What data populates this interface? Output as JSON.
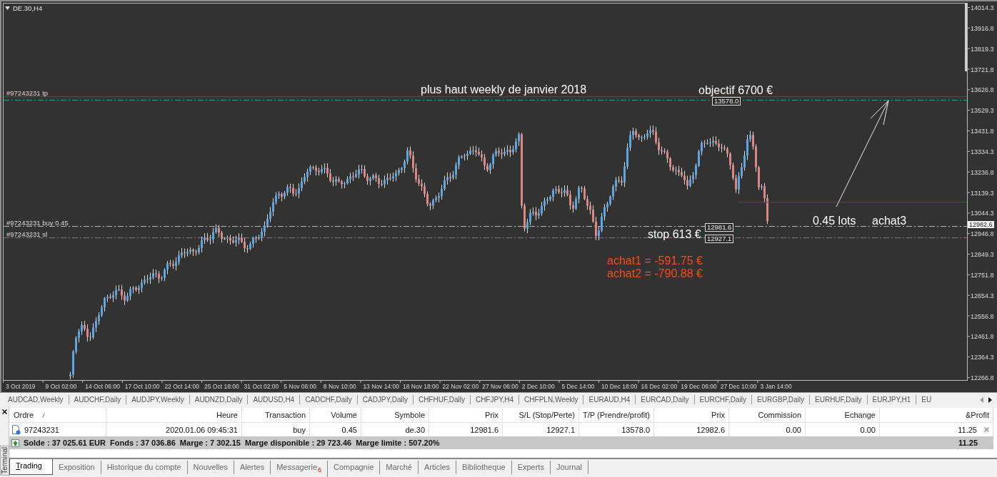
{
  "chart": {
    "title": "DE.30,H4",
    "trade_lines": [
      {
        "kind": "tp",
        "label": "#97243231 tp",
        "price_tag": "13578.0"
      },
      {
        "kind": "buy",
        "label": "#97243231 buy 0.45",
        "price_tag": "12981.6"
      },
      {
        "kind": "sl",
        "label": "#97243231 sl",
        "price_tag": "12927.1"
      }
    ],
    "notes": [
      {
        "kind": "resistance",
        "text": "plus haut weekly de janvier 2018"
      },
      {
        "kind": "target",
        "text": "objectif 6700 €"
      },
      {
        "kind": "lots",
        "text": "0.45 lots"
      },
      {
        "kind": "position",
        "text": "achat3"
      },
      {
        "kind": "stop",
        "text": "stop 613 €"
      }
    ],
    "losses": [
      "achat1 = -591.75 €",
      "achat2 = -790.88 €"
    ],
    "price_axis": {
      "labels": [
        "14014.3",
        "13916.8",
        "13819.3",
        "13721.8",
        "13626.8",
        "13529.3",
        "13431.8",
        "13334.3",
        "13236.8",
        "13139.3",
        "13044.3",
        "12946.8",
        "12849.3",
        "12751.8",
        "12654.3",
        "12556.8",
        "12461.8",
        "12364.3",
        "12266.8"
      ],
      "current": "12982.6"
    },
    "time_axis": {
      "labels": [
        "3 Oct 2019",
        "9 Oct 02:00",
        "14 Oct 06:00",
        "17 Oct 10:00",
        "22 Oct 14:00",
        "25 Oct 18:00",
        "31 Oct 02:00",
        "5 Nov 06:00",
        "8 Nov 10:00",
        "13 Nov 14:00",
        "18 Nov 18:00",
        "22 Nov 02:00",
        "27 Nov 06:00",
        "2 Dec 10:00",
        "5 Dec 14:00",
        "10 Dec 18:00",
        "16 Dec 02:00",
        "19 Dec 06:00",
        "27 Dec 10:00",
        "3 Jan 14:00"
      ]
    }
  },
  "symbol_tabs": [
    {
      "label": "AUDCAD,Weekly"
    },
    {
      "label": "AUDCHF,Daily"
    },
    {
      "label": "AUDJPY,Weekly"
    },
    {
      "label": "AUDNZD,Daily"
    },
    {
      "label": "AUDUSD,H4"
    },
    {
      "label": "CADCHF,Daily"
    },
    {
      "label": "CADJPY,Daily"
    },
    {
      "label": "CHFHUF,Daily"
    },
    {
      "label": "CHFJPY,H4"
    },
    {
      "label": "CHFPLN,Weekly"
    },
    {
      "label": "EURAUD,H4"
    },
    {
      "label": "EURCAD,Daily"
    },
    {
      "label": "EURCHF,Daily"
    },
    {
      "label": "EURGBP,Daily"
    },
    {
      "label": "EURHUF,Daily"
    },
    {
      "label": "EURJPY,H1"
    },
    {
      "label": "EU"
    }
  ],
  "terminal": {
    "title": "Terminal",
    "columns": [
      "Ordre",
      "Heure",
      "Transaction",
      "Volume",
      "Symbole",
      "Prix",
      "S/L (Stop/Perte)",
      "T/P (Prendre/profit)",
      "Prix",
      "Commission",
      "Echange",
      "&Profit"
    ],
    "rows": [
      {
        "cells": [
          "97243231",
          "2020.01.06 09:45:31",
          "buy",
          "0.45",
          "de.30",
          "12981.6",
          "12927.1",
          "13578.0",
          "12982.6",
          "0.00",
          "0.00",
          "11.25"
        ]
      }
    ],
    "summary": {
      "text": "Solde : 37 025.61 EUR  Fonds : 37 036.86  Marge : 7 302.15  Marge disponible : 29 723.46  Marge limite : 507.20%",
      "profit": "11.25"
    },
    "tabs": [
      {
        "label": "Trading",
        "selected": true
      },
      {
        "label": "Exposition",
        "selected": false
      },
      {
        "label": "Historique du compte",
        "selected": false
      },
      {
        "label": "Nouvelles",
        "selected": false
      },
      {
        "label": "Alertes",
        "selected": false
      },
      {
        "label": "Messagerie",
        "selected": false,
        "badge": "6"
      },
      {
        "label": "Compagnie",
        "selected": false
      },
      {
        "label": "Marché",
        "selected": false
      },
      {
        "label": "Articles",
        "selected": false
      },
      {
        "label": "Bibliotheque",
        "selected": false
      },
      {
        "label": "Experts",
        "selected": false
      },
      {
        "label": "Journal",
        "selected": false
      }
    ]
  }
}
